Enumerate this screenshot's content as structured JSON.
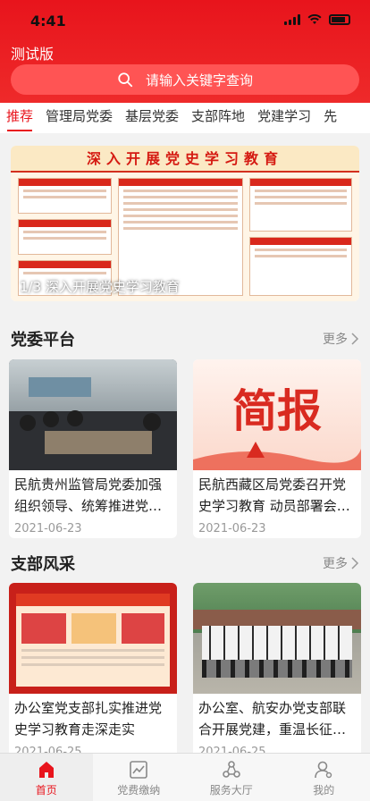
{
  "status": {
    "time": "4:41"
  },
  "app": {
    "title": "测试版"
  },
  "search": {
    "placeholder": "请输入关键字查询"
  },
  "tabs": [
    {
      "label": "推荐",
      "active": true
    },
    {
      "label": "管理局党委"
    },
    {
      "label": "基层党委"
    },
    {
      "label": "支部阵地"
    },
    {
      "label": "党建学习"
    },
    {
      "label": "先"
    }
  ],
  "banner": {
    "title": "深入开展党史学习教育",
    "caption": "1/3 深入开展党史学习教育"
  },
  "sections": [
    {
      "title": "党委平台",
      "more": "更多",
      "cards": [
        {
          "title": "民航贵州监管局党委加强组织领导、统筹推进党史...",
          "date": "2021-06-23",
          "image": "meeting-photo"
        },
        {
          "title": "民航西藏区局党委召开党史学习教育 动员部署会部...",
          "date": "2021-06-23",
          "image": "jianbao-poster"
        }
      ]
    },
    {
      "title": "支部风采",
      "more": "更多",
      "cards": [
        {
          "title": "办公室党支部扎实推进党史学习教育走深走实",
          "date": "2021-06-25",
          "image": "celebration-board"
        },
        {
          "title": "办公室、航安办党支部联合开展党建，重温长征精神...",
          "date": "2021-06-25",
          "image": "group-photo"
        }
      ]
    }
  ],
  "tabbar": [
    {
      "label": "首页",
      "icon": "home-icon",
      "active": true
    },
    {
      "label": "党费缴纳",
      "icon": "chart-icon"
    },
    {
      "label": "服务大厅",
      "icon": "service-icon"
    },
    {
      "label": "我的",
      "icon": "user-icon"
    }
  ],
  "colors": {
    "primary": "#e8141c",
    "search_bg": "#ff5454"
  }
}
